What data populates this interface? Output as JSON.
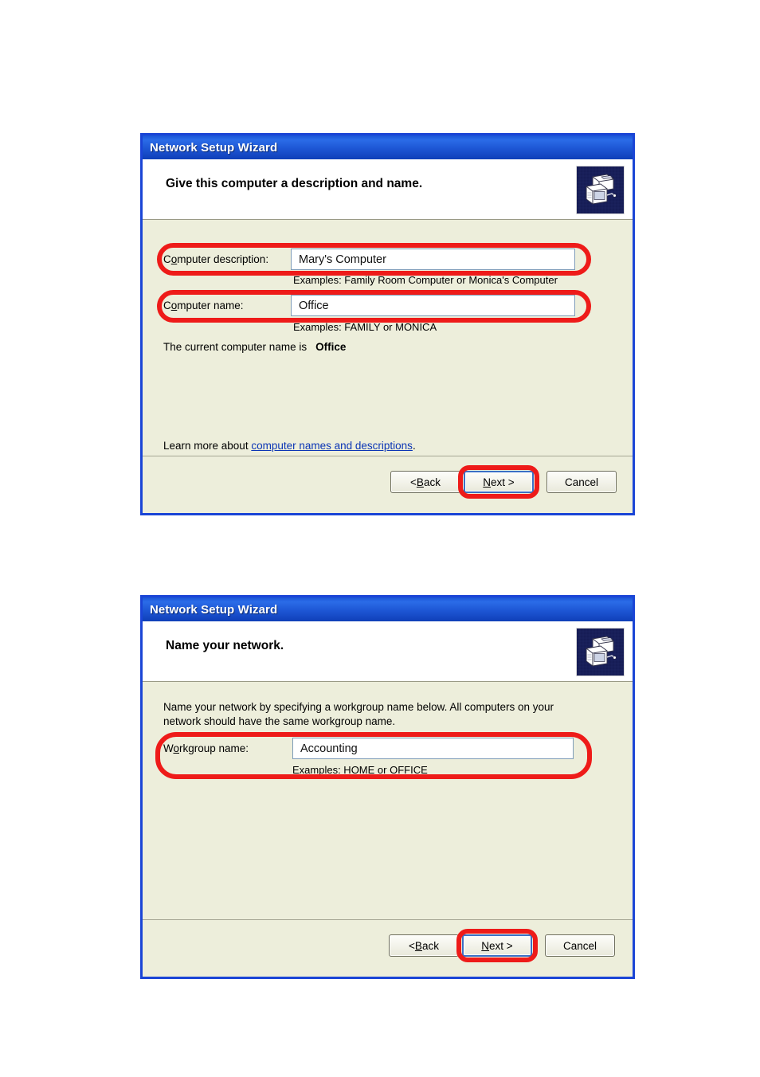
{
  "page": {
    "background": "#ffffff",
    "accent_red": "#ee1b19",
    "titlebar_blue": "#1b55d6",
    "body_beige": "#edeedb"
  },
  "dialog1": {
    "title": "Network Setup Wizard",
    "heading": "Give this computer a description and name.",
    "icon": "network-computers-icon",
    "fields": [
      {
        "label_before": "C",
        "label_accel": "o",
        "label_after": "mputer description:",
        "value": "Mary's Computer",
        "example": "Examples: Family Room Computer or Monica's Computer"
      },
      {
        "label_before": "C",
        "label_accel": "o",
        "label_after": "mputer name:",
        "value": "Office",
        "example": "Examples: FAMILY or MONICA"
      }
    ],
    "current_name_label": "The current computer name is",
    "current_name_value": "Office",
    "learn_more_prefix": "Learn more about ",
    "learn_more_link": "computer names and descriptions",
    "learn_more_suffix": ".",
    "buttons": {
      "back": {
        "text_before": "< ",
        "accel": "B",
        "text_after": "ack"
      },
      "next": {
        "accel": "N",
        "text_after": "ext >"
      },
      "cancel": {
        "label": "Cancel"
      }
    }
  },
  "dialog2": {
    "title": "Network Setup Wizard",
    "heading": "Name your network.",
    "icon": "network-computers-icon",
    "paragraph": "Name your network by specifying a workgroup name below. All computers on your network should have the same workgroup name.",
    "field": {
      "label_before": "W",
      "label_accel": "o",
      "label_after": "rkgroup name:",
      "value": "Accounting",
      "example": "Examples: HOME or OFFICE"
    },
    "buttons": {
      "back": {
        "text_before": "< ",
        "accel": "B",
        "text_after": "ack"
      },
      "next": {
        "accel": "N",
        "text_after": "ext >"
      },
      "cancel": {
        "label": "Cancel"
      }
    }
  }
}
